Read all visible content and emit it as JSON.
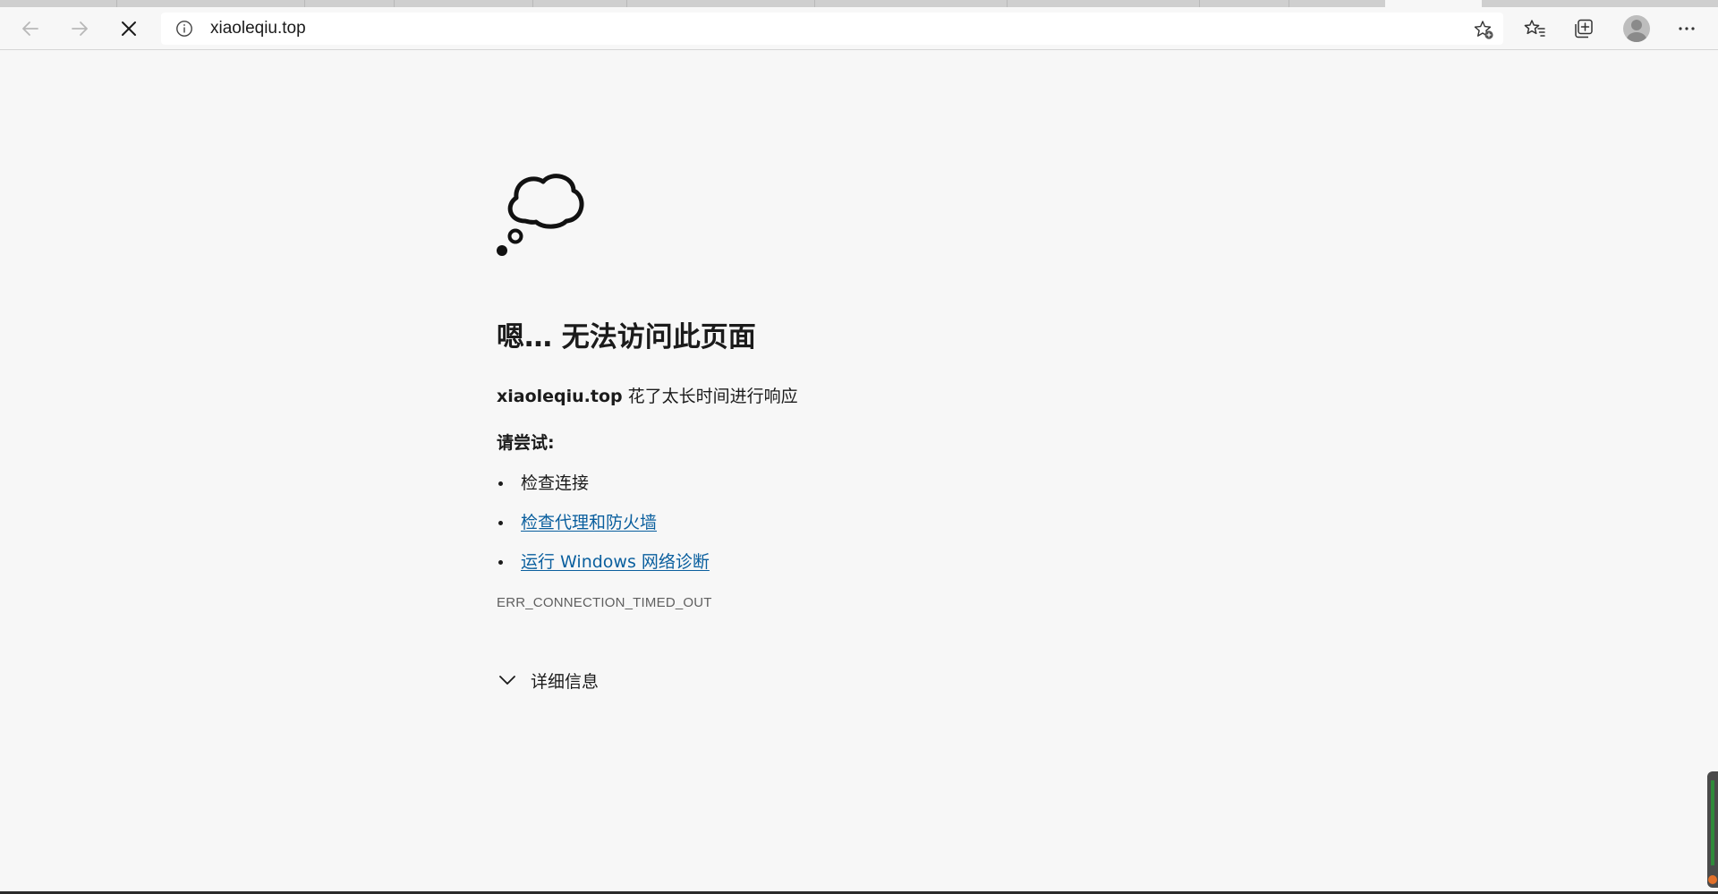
{
  "toolbar": {
    "url": "xiaoleqiu.top",
    "icons": [
      "back-icon",
      "forward-icon",
      "stop-icon",
      "info-icon",
      "add-favorite-icon",
      "favorites-icon",
      "collections-icon",
      "profile-icon",
      "more-icon"
    ]
  },
  "error": {
    "title": "嗯… 无法访问此页面",
    "host": "xiaoleqiu.top",
    "message": " 花了太长时间进行响应",
    "try_label": "请尝试:",
    "suggestions": [
      {
        "label": "检查连接",
        "link": false
      },
      {
        "label": "检查代理和防火墙",
        "link": true
      },
      {
        "label": "运行 Windows 网络诊断",
        "link": true
      }
    ],
    "code": "ERR_CONNECTION_TIMED_OUT",
    "details_label": "详细信息"
  },
  "colors": {
    "background": "#f7f7f7",
    "link": "#0a5f9e",
    "text": "#1b1b1b",
    "code": "#5f5f5f"
  }
}
